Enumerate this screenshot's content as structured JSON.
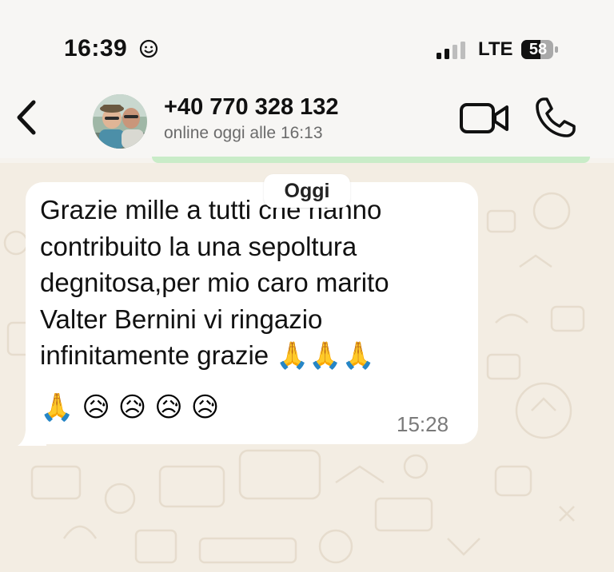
{
  "status_bar": {
    "time": "16:39",
    "network": "LTE",
    "battery": "58",
    "icons": [
      "smiley-face-icon",
      "cellular-signal-icon",
      "battery-icon"
    ]
  },
  "header": {
    "contact_name": "+40 770 328 132",
    "contact_status": "online oggi alle 16:13",
    "icons": [
      "back-chevron-icon",
      "video-call-icon",
      "phone-call-icon"
    ]
  },
  "chat": {
    "date_label": "Oggi",
    "messages": [
      {
        "text": "Grazie mille a tutti che hanno\ncontribuito la una sepoltura\ndegnitosa,per mio caro marito\nValter Bernini vi ringazio\ninfinitamente grazie 🙏🙏🙏",
        "emoji_line": [
          "🙏",
          "😥",
          "😥",
          "😥",
          "😥"
        ],
        "time": "15:28"
      }
    ]
  },
  "colors": {
    "chat_background": "#f3ede3",
    "bubble": "#ffffff",
    "header_background": "#f7f6f4",
    "accent_underline": "#c9ecc8"
  }
}
